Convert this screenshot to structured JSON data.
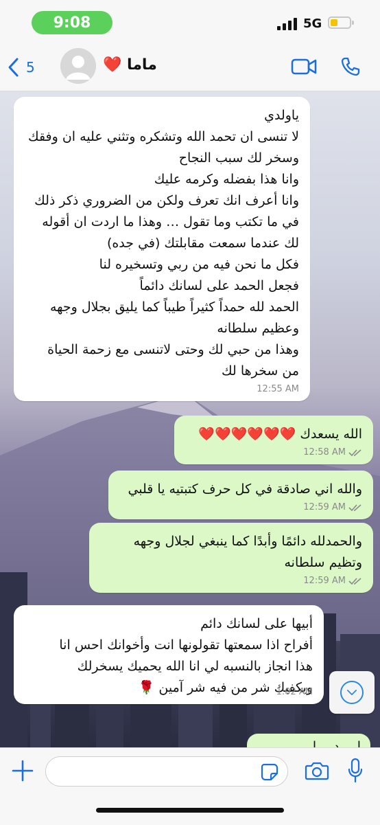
{
  "status_bar": {
    "time": "9:08",
    "network": "5G"
  },
  "header": {
    "back_count": "5",
    "contact_name": "ماما ❤️"
  },
  "messages": [
    {
      "direction": "incoming",
      "lines": [
        "ياولدي",
        "لا تنسى ان تحمد الله وتشكره وتثني عليه ان وفقك",
        "وسخر لك سبب النجاح",
        "وانا هذا بفضله وكرمه عليك",
        "وانا أعرف انك تعرف ولكن من الضروري ذكر ذلك",
        "في ما تكتب وما تقول … وهذا ما اردت ان أقوله",
        "لك عندما سمعت مقابلتك (في جده)",
        "فكل ما نحن فيه من ربي وتسخيره لنا",
        "فجعل الحمد على لسانك دائماً",
        "الحمد لله حمداً كثيراً طيباً كما يليق بجلال وجهه",
        "وعظيم سلطانه",
        "وهذا من حبي لك وحتى لاتنسى مع زحمة الحياة",
        "من سخرها لك"
      ],
      "time": "12:55 AM"
    },
    {
      "direction": "outgoing",
      "lines": [
        "الله يسعدك ❤️❤️❤️❤️❤️❤️"
      ],
      "time": "12:58 AM"
    },
    {
      "direction": "outgoing",
      "lines": [
        "والله اني صادقة في كل حرف كتبتيه يا قلبي"
      ],
      "time": "12:59 AM"
    },
    {
      "direction": "outgoing",
      "lines": [
        "والحمدلله دائمًا وأبدًا كما ينبغي لجلال وجهه",
        "وتظيم سلطانه"
      ],
      "time": "12:59 AM"
    },
    {
      "direction": "incoming",
      "lines": [
        "أبيها على لسانك دائم",
        "أفراح اذا سمعتها تقولونها انت وأخوانك احس انا",
        "هذا انجاز بالنسبه لي انا الله يحميك يسخرلك",
        "ويكفيك شر من فيه شر آمين 🌹"
      ],
      "time": "1:02 AM"
    }
  ],
  "partial_message": "ا…ـد…ـا…ـي …",
  "input": {
    "value": "",
    "placeholder": ""
  },
  "icons": {
    "back": "chevron-left-icon",
    "video": "video-call-icon",
    "phone": "phone-call-icon",
    "plus": "plus-icon",
    "sticker": "sticker-icon",
    "camera": "camera-icon",
    "mic": "microphone-icon",
    "scroll_down": "chevron-down-icon"
  },
  "colors": {
    "accent": "#1a6ee0",
    "outgoing_bubble": "#dbf8c6",
    "incoming_bubble": "#ffffff",
    "time_pill": "#5bd05b",
    "battery": "#f5c400"
  }
}
